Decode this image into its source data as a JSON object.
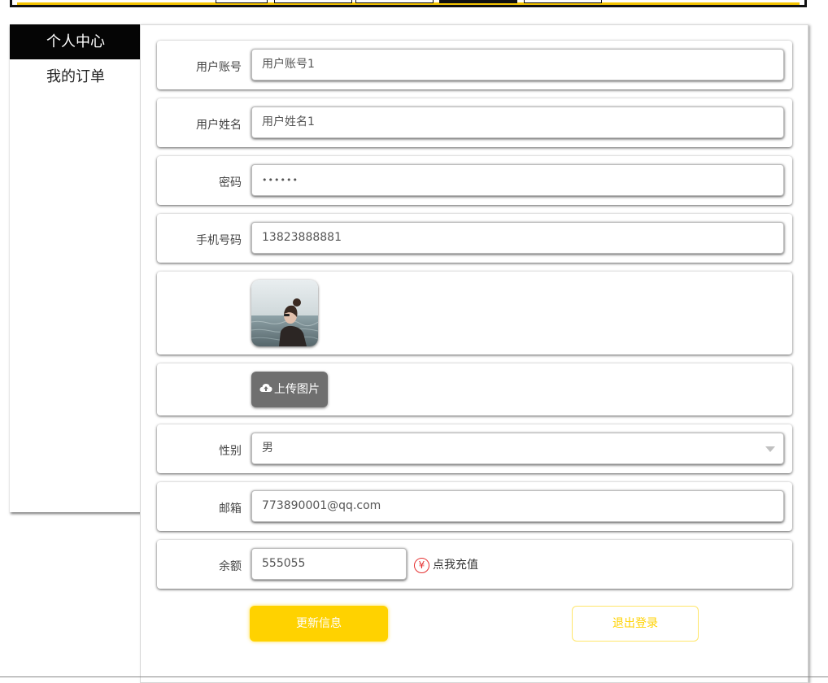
{
  "sidebar": {
    "items": [
      {
        "label": "个人中心",
        "active": true
      },
      {
        "label": "我的订单",
        "active": false
      }
    ]
  },
  "form": {
    "account": {
      "label": "用户账号",
      "value": "用户账号1"
    },
    "name": {
      "label": "用户姓名",
      "value": "用户姓名1"
    },
    "password": {
      "label": "密码",
      "value": "••••••"
    },
    "phone": {
      "label": "手机号码",
      "value": "13823888881"
    },
    "upload": {
      "label": "上传图片",
      "icon": "cloud-upload-icon"
    },
    "gender": {
      "label": "性别",
      "value": "男"
    },
    "email": {
      "label": "邮箱",
      "value": "773890001@qq.com"
    },
    "balance": {
      "label": "余额",
      "value": "555055",
      "recharge_label": "点我充值",
      "recharge_icon": "¥"
    }
  },
  "actions": {
    "update_label": "更新信息",
    "logout_label": "退出登录"
  },
  "colors": {
    "accent": "#ffd200",
    "upload_button": "#6f6f6f",
    "recharge_icon": "#e53030"
  }
}
